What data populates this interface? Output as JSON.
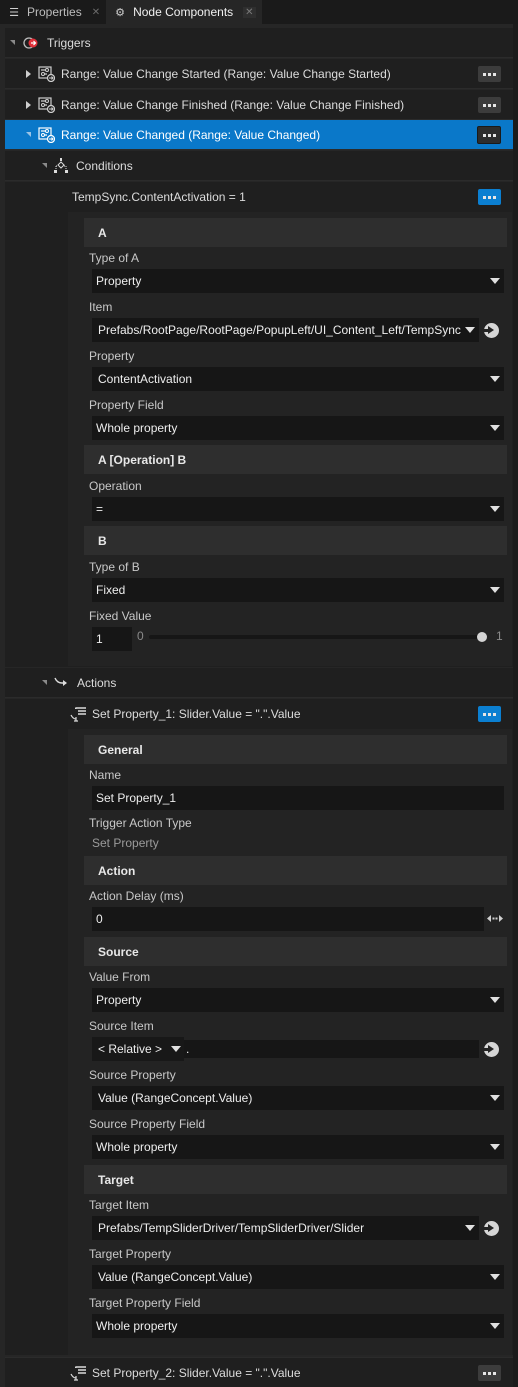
{
  "tabs": [
    {
      "label": "Properties",
      "icon": "list-icon",
      "active": false
    },
    {
      "label": "Node Components",
      "icon": "components-icon",
      "active": true
    }
  ],
  "triggers_header": {
    "label": "Triggers",
    "icon": "trigger-icon",
    "icon_color": "#e0303a"
  },
  "triggers": [
    {
      "label": "Range: Value Change Started (Range: Value Change Started)",
      "expanded": false,
      "selected": false
    },
    {
      "label": "Range: Value Change Finished (Range: Value Change Finished)",
      "expanded": false,
      "selected": false
    },
    {
      "label": "Range: Value Changed (Range: Value Changed)",
      "expanded": true,
      "selected": true
    }
  ],
  "conditions": {
    "label": "Conditions",
    "item_label": "TempSync.ContentActivation = 1",
    "sections": {
      "a": "A",
      "op": "A [Operation] B",
      "b": "B"
    },
    "type_of_a": {
      "label": "Type of A",
      "value": "Property"
    },
    "item": {
      "label": "Item",
      "value": "Prefabs/RootPage/RootPage/PopupLeft/UI_Content_Left/TempSync"
    },
    "property": {
      "label": "Property",
      "value": "ContentActivation"
    },
    "property_field": {
      "label": "Property Field",
      "value": "Whole property"
    },
    "operation": {
      "label": "Operation",
      "value": "="
    },
    "type_of_b": {
      "label": "Type of B",
      "value": "Fixed"
    },
    "fixed_value": {
      "label": "Fixed Value",
      "value": "1",
      "min": "0",
      "max": "1",
      "slider_fraction": 1.0
    }
  },
  "actions": {
    "label": "Actions",
    "items": [
      {
        "label": "Set Property_1: Slider.Value = \".\".Value",
        "expanded": true
      },
      {
        "label": "Set Property_2: Slider.Value = \".\".Value",
        "expanded": false
      }
    ],
    "sections": {
      "general": "General",
      "action": "Action",
      "source": "Source",
      "target": "Target"
    },
    "name": {
      "label": "Name",
      "value": "Set Property_1"
    },
    "trigger_action_type": {
      "label": "Trigger Action Type",
      "value": "Set Property"
    },
    "action_delay": {
      "label": "Action Delay (ms)",
      "value": "0"
    },
    "value_from": {
      "label": "Value From",
      "value": "Property"
    },
    "source_item": {
      "label": "Source Item",
      "mode": "< Relative >",
      "value": "."
    },
    "source_property": {
      "label": "Source Property",
      "value": "Value (RangeConcept.Value)"
    },
    "source_property_field": {
      "label": "Source Property Field",
      "value": "Whole property"
    },
    "target_item": {
      "label": "Target Item",
      "value": "Prefabs/TempSliderDriver/TempSliderDriver/Slider"
    },
    "target_property": {
      "label": "Target Property",
      "value": "Value (RangeConcept.Value)"
    },
    "target_property_field": {
      "label": "Target Property Field",
      "value": "Whole property"
    }
  },
  "colors": {
    "accent": "#0a78c9",
    "more_button_blue": "#0b7fd1",
    "background": "#1f1f1f",
    "field": "#161616",
    "section": "#2e2e2e"
  }
}
